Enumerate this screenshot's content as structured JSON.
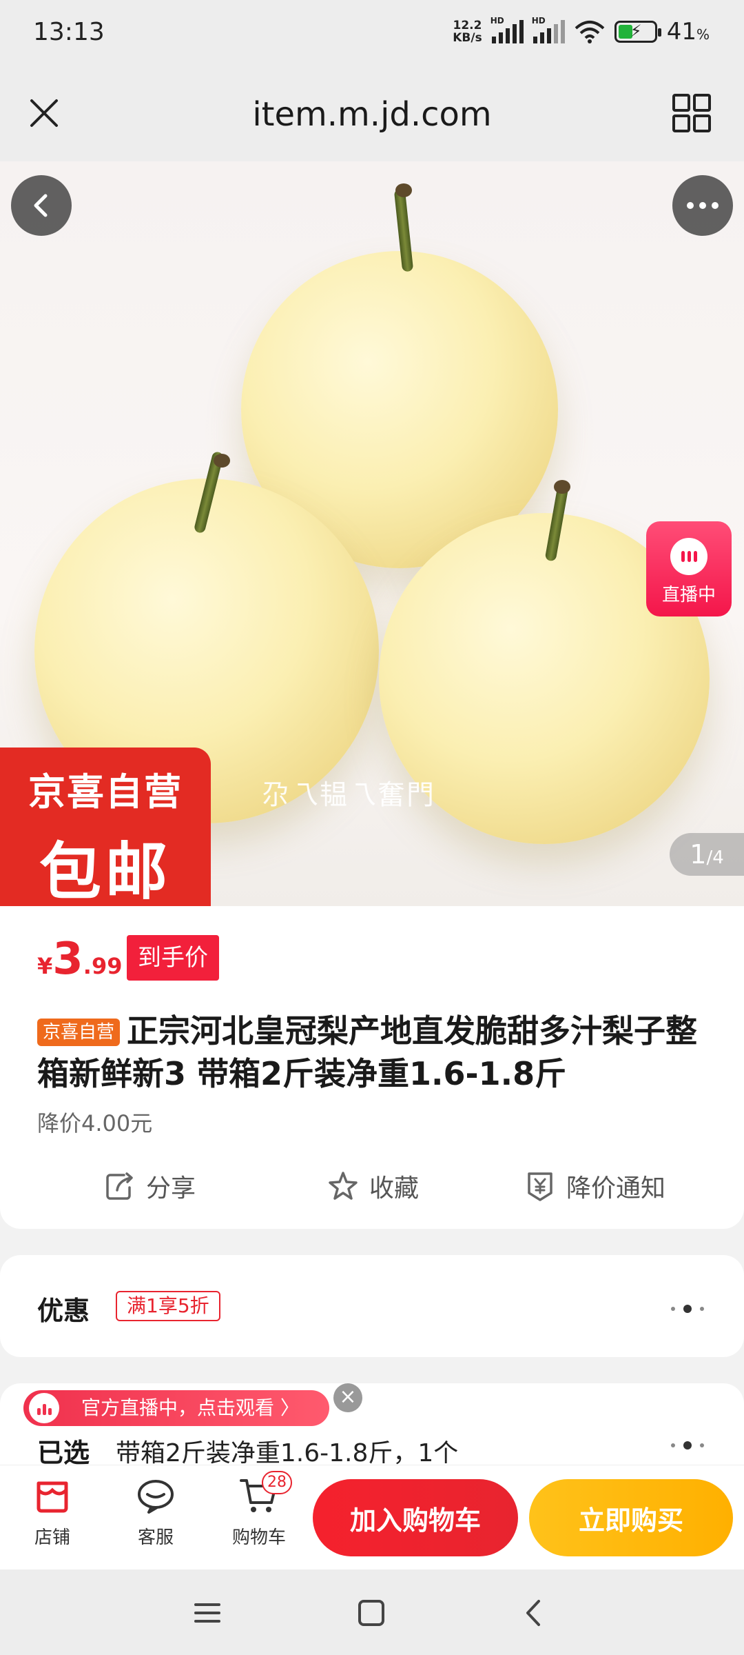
{
  "status_bar": {
    "time": "13:13",
    "net_speed_value": "12.2",
    "net_speed_unit": "KB/s",
    "sim1_label": "HD",
    "sim2_label": "HD",
    "battery_percent": "41",
    "battery_unit": "%"
  },
  "browser": {
    "url": "item.m.jd.com",
    "close_icon": "close-icon",
    "menu_icon": "grid-icon"
  },
  "gallery": {
    "overlay_text": "尕乁韫乁奮門",
    "promo_line1": "京喜自营",
    "promo_line2": "包邮",
    "live_badge": "直播中",
    "counter_current": "1",
    "counter_total": "/4"
  },
  "product": {
    "price_symbol": "¥",
    "price_int": "3",
    "price_dec": ".99",
    "price_tag": "到手价",
    "self_op_tag": "京喜自营",
    "title": "正宗河北皇冠梨产地直发脆甜多汁梨子整箱新鲜新3 带箱2斤装净重1.6-1.8斤",
    "price_drop": "降价4.00元",
    "actions": {
      "share": "分享",
      "favorite": "收藏",
      "price_alert": "降价通知"
    }
  },
  "coupon": {
    "label": "优惠",
    "tag": "满1享5折"
  },
  "selection": {
    "live_pill": "官方直播中，点击观看 〉",
    "label": "已选",
    "value": "带箱2斤装净重1.6-1.8斤，1个"
  },
  "bottom_bar": {
    "store": "店铺",
    "service": "客服",
    "cart": "购物车",
    "cart_count": "28",
    "add_to_cart": "加入购物车",
    "buy_now": "立即购买"
  },
  "colors": {
    "accent_red": "#e8242f",
    "buy_yellow": "#ffb000",
    "tag_orange": "#ef6a1c"
  }
}
